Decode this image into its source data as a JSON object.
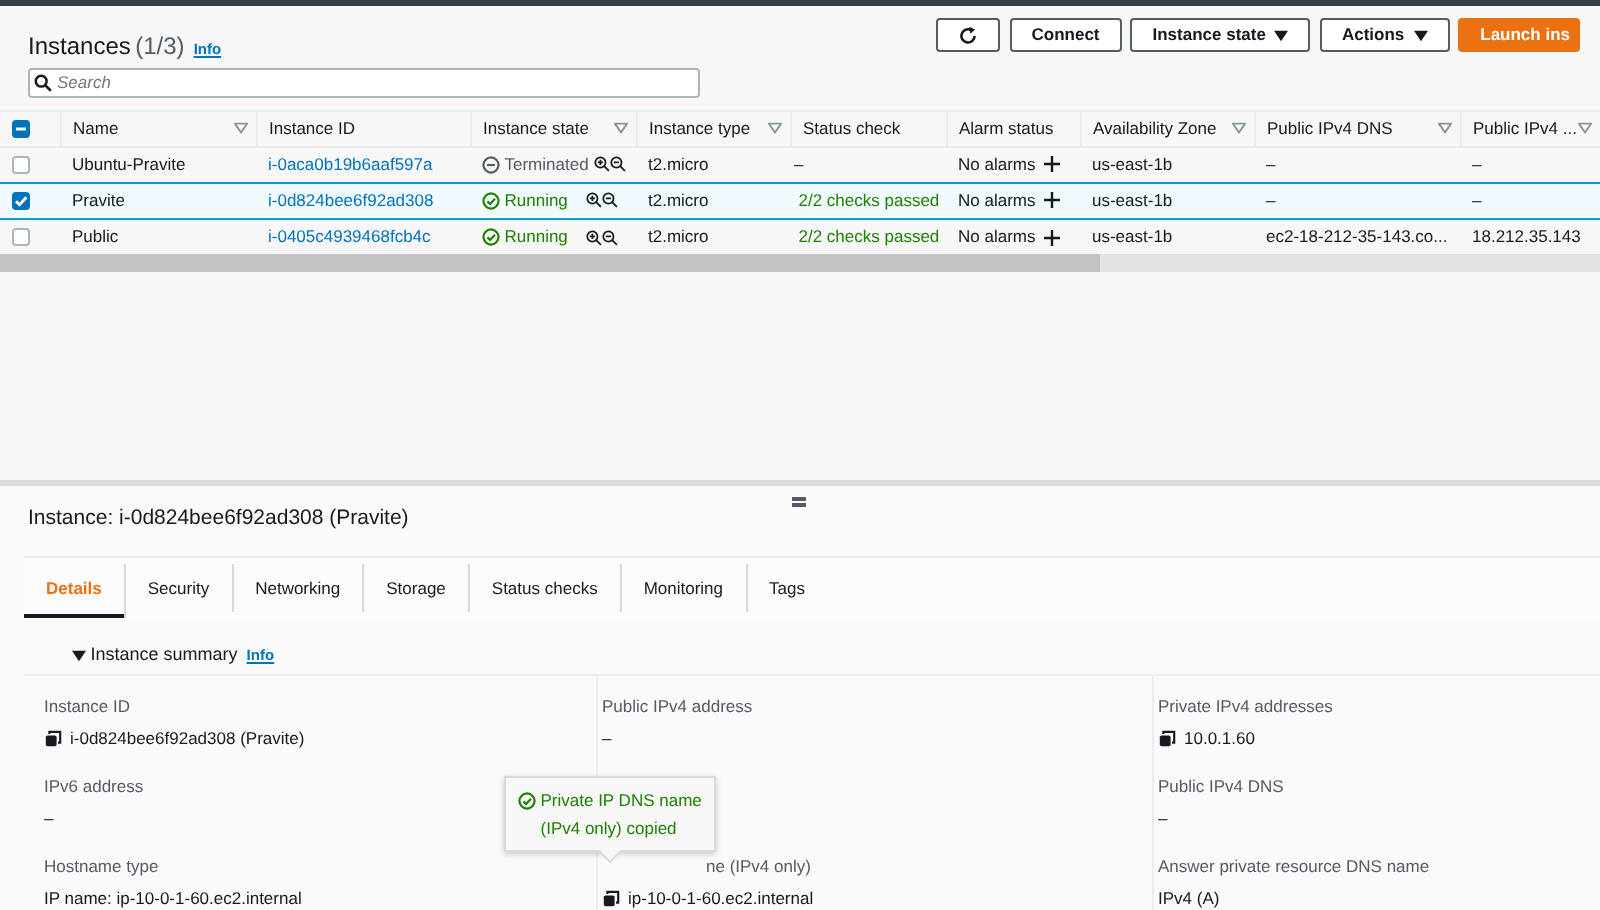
{
  "header": {
    "title": "Instances",
    "count": "(1/3)",
    "info": "Info"
  },
  "toolbar": [
    {
      "kind": "refresh"
    },
    {
      "kind": "button",
      "label": "Connect"
    },
    {
      "kind": "dropdown",
      "label": "Instance state"
    },
    {
      "kind": "dropdown",
      "label": "Actions"
    },
    {
      "kind": "primary",
      "label": "Launch ins"
    }
  ],
  "search": {
    "placeholder": "Search"
  },
  "table": {
    "select_all": {
      "checked": true,
      "partial": true
    },
    "columns": [
      {
        "label": "Name",
        "filter": true
      },
      {
        "label": "Instance ID",
        "filter": false
      },
      {
        "label": "Instance state",
        "filter": true
      },
      {
        "label": "Instance type",
        "filter": true
      },
      {
        "label": "Status check",
        "filter": false
      },
      {
        "label": "Alarm status",
        "filter": false
      },
      {
        "label": "Availability Zone",
        "filter": true
      },
      {
        "label": "Public IPv4 DNS",
        "filter": true
      },
      {
        "label": "Public IPv4 ...",
        "filter": true
      }
    ],
    "rows": [
      {
        "selected": false,
        "name": "Ubuntu-Pravite",
        "id": "i-0aca0b19b6aaf597a",
        "state": {
          "kind": "terminated",
          "label": "Terminated"
        },
        "type": "t2.micro",
        "status": {
          "passed": false,
          "label": "–"
        },
        "alarm": "No alarms",
        "zone": "us-east-1b",
        "dns": "–",
        "ipv4": "–"
      },
      {
        "selected": true,
        "name": "Pravite",
        "id": "i-0d824bee6f92ad308",
        "state": {
          "kind": "running",
          "label": "Running"
        },
        "type": "t2.micro",
        "status": {
          "passed": true,
          "label": "2/2 checks passed"
        },
        "alarm": "No alarms",
        "zone": "us-east-1b",
        "dns": "–",
        "ipv4": "–"
      },
      {
        "selected": false,
        "name": "Public",
        "id": "i-0405c4939468fcb4c",
        "state": {
          "kind": "running",
          "label": "Running"
        },
        "type": "t2.micro",
        "status": {
          "passed": true,
          "label": "2/2 checks passed"
        },
        "alarm": "No alarms",
        "zone": "us-east-1b",
        "dns": "ec2-18-212-35-143.co...",
        "ipv4": "18.212.35.143"
      }
    ]
  },
  "details": {
    "title": "Instance: i-0d824bee6f92ad308 (Pravite)",
    "tabs": [
      {
        "label": "Details",
        "selected": true
      },
      {
        "label": "Security",
        "selected": false
      },
      {
        "label": "Networking",
        "selected": false
      },
      {
        "label": "Storage",
        "selected": false
      },
      {
        "label": "Status checks",
        "selected": false
      },
      {
        "label": "Monitoring",
        "selected": false
      },
      {
        "label": "Tags",
        "selected": false
      }
    ],
    "section": {
      "title": "Instance summary",
      "info": "Info",
      "expanded": true
    },
    "columns": [
      [
        {
          "label": "Instance ID",
          "value": "i-0d824bee6f92ad308 (Pravite)",
          "copy": true
        },
        {
          "label": "IPv6 address",
          "value": "–",
          "copy": false
        },
        {
          "label": "Hostname type",
          "value": "IP name: ip-10-0-1-60.ec2.internal",
          "copy": false
        }
      ],
      [
        {
          "label": "Public IPv4 address",
          "value": "–",
          "copy": false
        },
        {
          "label": "ne (IPv4 only)",
          "value": "ip-10-0-1-60.ec2.internal",
          "copy": true,
          "covered": true
        }
      ],
      [
        {
          "label": "Private IPv4 addresses",
          "value": "10.0.1.60",
          "copy": true
        },
        {
          "label": "Public IPv4 DNS",
          "value": "–",
          "copy": false
        },
        {
          "label": "Answer private resource DNS name",
          "value": "IPv4 (A)",
          "copy": false
        }
      ]
    ],
    "tooltip": {
      "text": "Private IP DNS name (IPv4 only) copied"
    }
  }
}
